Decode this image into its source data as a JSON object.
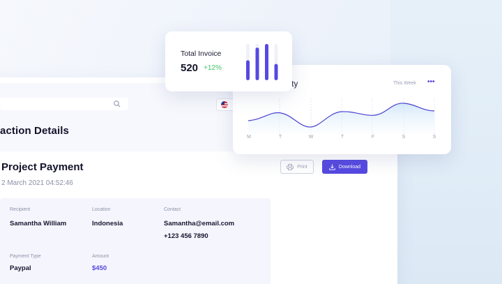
{
  "page": {
    "title": "action Details"
  },
  "search": {
    "placeholder": ""
  },
  "transaction": {
    "title": "Project Payment",
    "date": "2 March 2021 04:52:46",
    "print_label": "Print",
    "download_label": "Download"
  },
  "details": {
    "recipient_label": "Recipient",
    "recipient_value": "Samantha William",
    "location_label": "Location",
    "location_value": "Indonesia",
    "contact_label": "Contact",
    "contact_email": "Samantha@email.com",
    "contact_phone": "+123 456 7890",
    "payment_type_label": "Payment Type",
    "payment_type_value": "Paypal",
    "amount_label": "Amount",
    "amount_value": "$450"
  },
  "invoice": {
    "title": "Total Invoice",
    "value": "520",
    "change": "+12%",
    "bars": [
      0.55,
      0.9,
      1.0,
      0.45
    ]
  },
  "activity": {
    "title": "vity",
    "range": "This Week",
    "more": "•••",
    "days": [
      "M",
      "T",
      "W",
      "T",
      "F",
      "S",
      "S"
    ]
  },
  "colors": {
    "accent": "#5649e0",
    "positive": "#3fc766"
  },
  "icons": {
    "search": "search-icon",
    "flag": "us-flag-icon",
    "print": "printer-icon",
    "download": "download-icon",
    "more": "more-icon"
  }
}
